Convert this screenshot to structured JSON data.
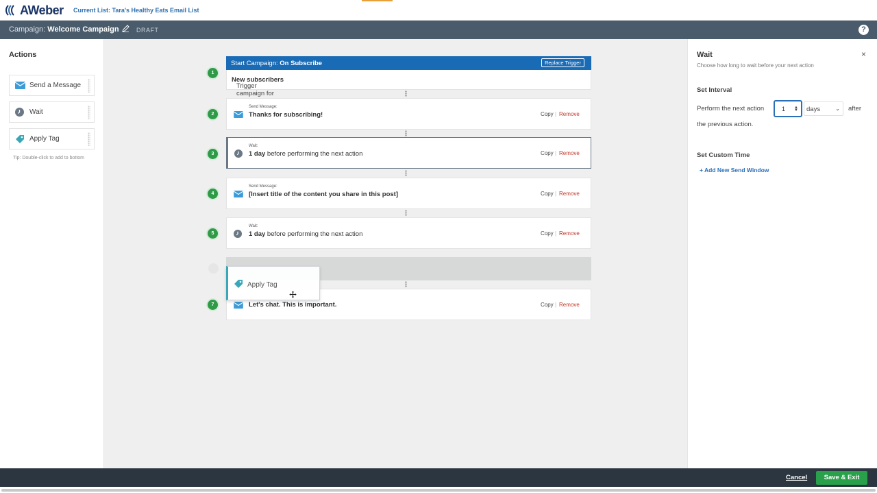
{
  "header": {
    "logo_text": "AWeber",
    "current_list": "Current List: Tara's Healthy Eats Email List"
  },
  "campaign_bar": {
    "label": "Campaign:",
    "name": "Welcome Campaign",
    "status": "DRAFT",
    "help": "?"
  },
  "actions_panel": {
    "title": "Actions",
    "items": [
      {
        "label": "Send a Message",
        "icon": "envelope-icon"
      },
      {
        "label": "Wait",
        "icon": "clock-icon"
      },
      {
        "label": "Apply Tag",
        "icon": "tag-icon"
      }
    ],
    "tip": "Tip: Double-click to add to bottom"
  },
  "canvas": {
    "trigger": {
      "step": "1",
      "head_label": "Start Campaign:",
      "head_value": "On Subscribe",
      "replace_label": "Replace Trigger",
      "body_label": "Trigger campaign for",
      "body_value": "New subscribers"
    },
    "steps": [
      {
        "num": "2",
        "type_label": "Send Message:",
        "bold": "Thanks for subscribing!",
        "rest": ""
      },
      {
        "num": "3",
        "type_label": "Wait:",
        "bold": "1 day",
        "rest": " before performing the next action"
      },
      {
        "num": "4",
        "type_label": "Send Message:",
        "bold": "[Insert title of the content you share in this post]",
        "rest": ""
      },
      {
        "num": "5",
        "type_label": "Wait:",
        "bold": "1 day",
        "rest": " before performing the next action"
      },
      {
        "num": "7",
        "type_label": "",
        "bold": "Let's chat. This is important.",
        "rest": ""
      }
    ],
    "copy_label": "Copy",
    "separator": "|",
    "remove_label": "Remove",
    "dragging_label": "Apply Tag"
  },
  "wait_panel": {
    "title": "Wait",
    "close": "×",
    "subtitle": "Choose how long to wait before your next action",
    "set_interval": "Set Interval",
    "perform_label": "Perform the next action",
    "interval_value": "1",
    "unit_value": "days",
    "after_label": "after",
    "previous_label": "the previous action.",
    "set_custom_time": "Set Custom Time",
    "add_window": "+ Add New Send Window"
  },
  "footer": {
    "cancel": "Cancel",
    "save": "Save & Exit"
  },
  "colors": {
    "brand_blue": "#1a6bb6",
    "step_green": "#2f9a47",
    "remove_red": "#c0392b",
    "save_green": "#29a04a"
  }
}
